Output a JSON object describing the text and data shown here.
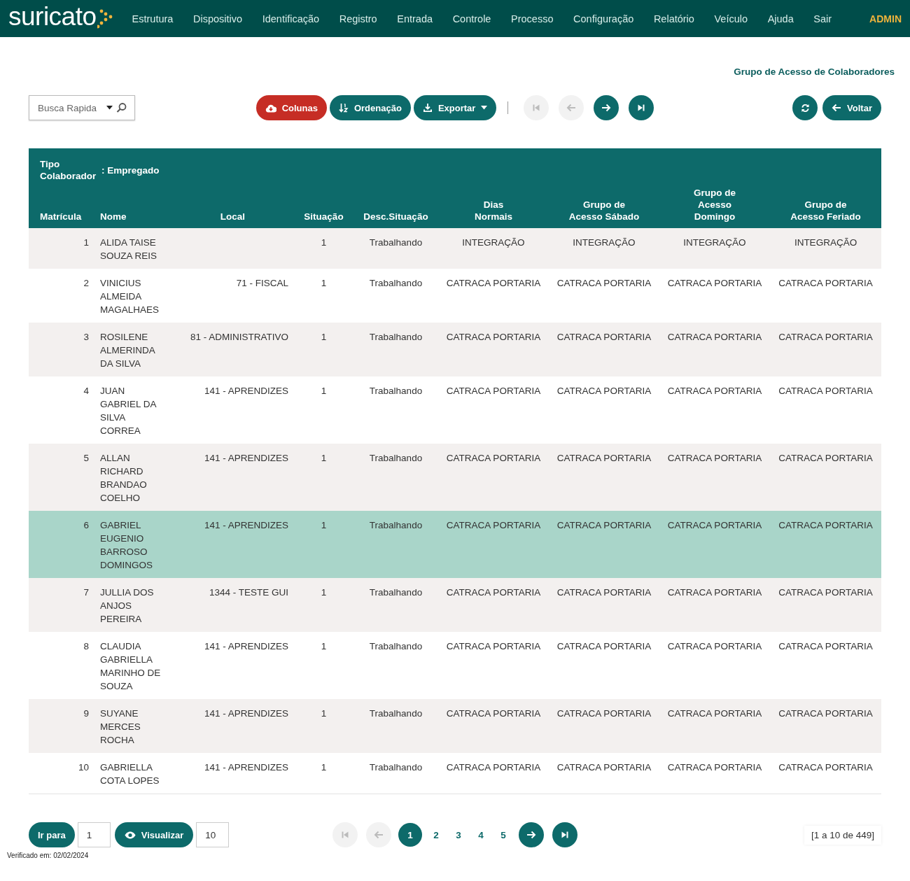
{
  "nav": {
    "logo": "suricato",
    "items": [
      "Estrutura",
      "Dispositivo",
      "Identificação",
      "Registro",
      "Entrada",
      "Controle",
      "Processo",
      "Configuração",
      "Relatório",
      "Veículo",
      "Ajuda",
      "Sair"
    ],
    "user": "ADMIN"
  },
  "page_title": "Grupo de Acesso de Colaboradores",
  "toolbar": {
    "search": {
      "placeholder": "Busca Rapida"
    },
    "actions": [
      {
        "kind": "columns",
        "label": "Colunas",
        "dropdown": false
      },
      {
        "kind": "sort",
        "label": "Ordenação",
        "dropdown": false
      },
      {
        "kind": "export",
        "label": "Exportar",
        "dropdown": true
      }
    ],
    "pager": [
      {
        "kind": "first",
        "disabled": true
      },
      {
        "kind": "prev",
        "disabled": true
      },
      {
        "kind": "next",
        "disabled": false
      },
      {
        "kind": "last",
        "disabled": false
      }
    ],
    "refresh": {
      "kind": "refresh"
    },
    "back": {
      "label": "Voltar"
    }
  },
  "table": {
    "group": {
      "label": "Tipo Colaborador",
      "value": ": Empregado"
    },
    "columns": [
      {
        "label": "Matrícula"
      },
      {
        "label": "Nome"
      },
      {
        "label": "Local"
      },
      {
        "label": "Situação"
      },
      {
        "label": "Desc.Situação"
      },
      {
        "label": "Dias Normais"
      },
      {
        "label": "Grupo de Acesso Sábado"
      },
      {
        "label": "Grupo de Acesso Domingo"
      },
      {
        "label": "Grupo de Acesso Feriado"
      }
    ],
    "rows": [
      {
        "selected": false,
        "cells": [
          "1",
          "ALIDA TAISE SOUZA REIS",
          "",
          "1",
          "Trabalhando",
          "INTEGRAÇÃO",
          "INTEGRAÇÃO",
          "INTEGRAÇÃO",
          "INTEGRAÇÃO"
        ]
      },
      {
        "selected": false,
        "cells": [
          "2",
          "VINICIUS ALMEIDA MAGALHAES",
          "71 - FISCAL",
          "1",
          "Trabalhando",
          "CATRACA PORTARIA",
          "CATRACA PORTARIA",
          "CATRACA PORTARIA",
          "CATRACA PORTARIA"
        ]
      },
      {
        "selected": false,
        "cells": [
          "3",
          "ROSILENE ALMERINDA DA SILVA",
          "81 - ADMINISTRATIVO",
          "1",
          "Trabalhando",
          "CATRACA PORTARIA",
          "CATRACA PORTARIA",
          "CATRACA PORTARIA",
          "CATRACA PORTARIA"
        ]
      },
      {
        "selected": false,
        "cells": [
          "4",
          "JUAN GABRIEL DA SILVA CORREA",
          "141 - APRENDIZES",
          "1",
          "Trabalhando",
          "CATRACA PORTARIA",
          "CATRACA PORTARIA",
          "CATRACA PORTARIA",
          "CATRACA PORTARIA"
        ]
      },
      {
        "selected": false,
        "cells": [
          "5",
          "ALLAN RICHARD BRANDAO COELHO",
          "141 - APRENDIZES",
          "1",
          "Trabalhando",
          "CATRACA PORTARIA",
          "CATRACA PORTARIA",
          "CATRACA PORTARIA",
          "CATRACA PORTARIA"
        ]
      },
      {
        "selected": true,
        "cells": [
          "6",
          "GABRIEL EUGENIO BARROSO DOMINGOS",
          "141 - APRENDIZES",
          "1",
          "Trabalhando",
          "CATRACA PORTARIA",
          "CATRACA PORTARIA",
          "CATRACA PORTARIA",
          "CATRACA PORTARIA"
        ]
      },
      {
        "selected": false,
        "cells": [
          "7",
          "JULLIA DOS ANJOS PEREIRA",
          "1344 - TESTE GUI",
          "1",
          "Trabalhando",
          "CATRACA PORTARIA",
          "CATRACA PORTARIA",
          "CATRACA PORTARIA",
          "CATRACA PORTARIA"
        ]
      },
      {
        "selected": false,
        "cells": [
          "8",
          "CLAUDIA GABRIELLA MARINHO DE SOUZA",
          "141 - APRENDIZES",
          "1",
          "Trabalhando",
          "CATRACA PORTARIA",
          "CATRACA PORTARIA",
          "CATRACA PORTARIA",
          "CATRACA PORTARIA"
        ]
      },
      {
        "selected": false,
        "cells": [
          "9",
          "SUYANE MERCES ROCHA",
          "141 - APRENDIZES",
          "1",
          "Trabalhando",
          "CATRACA PORTARIA",
          "CATRACA PORTARIA",
          "CATRACA PORTARIA",
          "CATRACA PORTARIA"
        ]
      },
      {
        "selected": false,
        "cells": [
          "10",
          "GABRIELLA COTA LOPES",
          "141 - APRENDIZES",
          "1",
          "Trabalhando",
          "CATRACA PORTARIA",
          "CATRACA PORTARIA",
          "CATRACA PORTARIA",
          "CATRACA PORTARIA"
        ]
      }
    ]
  },
  "footer": {
    "goto": {
      "label": "Ir para",
      "value": "1"
    },
    "view": {
      "label": "Visualizar",
      "value": "10"
    },
    "pager_start": [
      {
        "kind": "first",
        "disabled": true
      },
      {
        "kind": "prev",
        "disabled": true
      }
    ],
    "pages": [
      {
        "label": "1",
        "selected": true
      },
      {
        "label": "2",
        "selected": false
      },
      {
        "label": "3",
        "selected": false
      },
      {
        "label": "4",
        "selected": false
      },
      {
        "label": "5",
        "selected": false
      }
    ],
    "pager_end": [
      {
        "kind": "next",
        "disabled": false
      },
      {
        "kind": "last",
        "disabled": false
      }
    ],
    "range": "[1 a 10 de 449]"
  },
  "verified": "Verificado em: 02/02/2024"
}
